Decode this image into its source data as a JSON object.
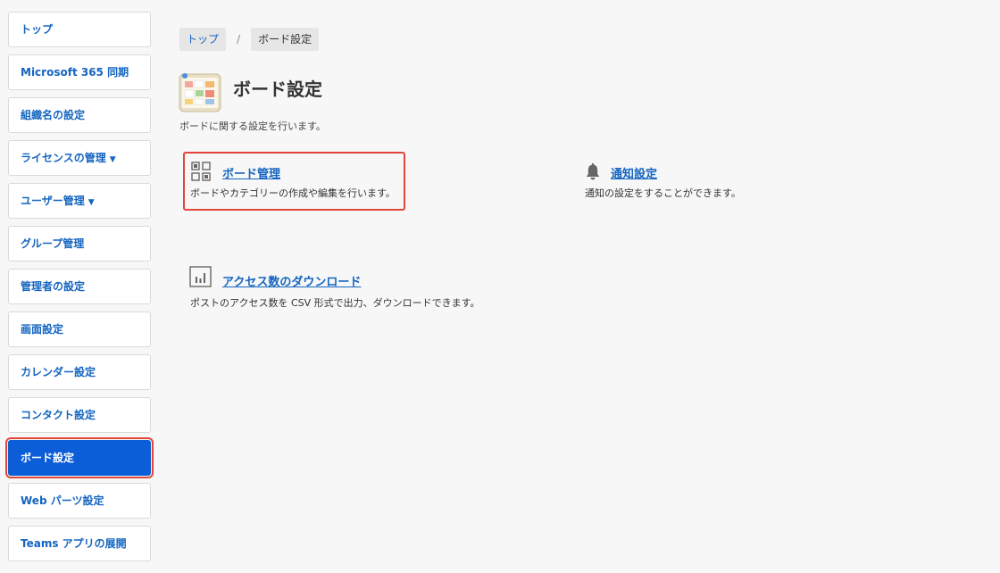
{
  "sidebar": {
    "items": [
      {
        "label": "トップ",
        "caret": ""
      },
      {
        "label": "Microsoft 365 同期",
        "caret": ""
      },
      {
        "label": "組織名の設定",
        "caret": ""
      },
      {
        "label": "ライセンスの管理",
        "caret": "▼"
      },
      {
        "label": "ユーザー管理",
        "caret": "▼"
      },
      {
        "label": "グループ管理",
        "caret": ""
      },
      {
        "label": "管理者の設定",
        "caret": ""
      },
      {
        "label": "画面設定",
        "caret": ""
      },
      {
        "label": "カレンダー設定",
        "caret": ""
      },
      {
        "label": "コンタクト設定",
        "caret": ""
      },
      {
        "label": "ボード設定",
        "caret": ""
      },
      {
        "label": "Web パーツ設定",
        "caret": ""
      },
      {
        "label": "Teams アプリの展開",
        "caret": ""
      }
    ],
    "active_index": 10
  },
  "breadcrumb": {
    "home": "トップ",
    "separator": "/",
    "current": "ボード設定"
  },
  "header": {
    "title": "ボード設定",
    "description": "ボードに関する設定を行います。",
    "icon": "board-app-icon"
  },
  "cards": {
    "board_manage": {
      "title": "ボード管理",
      "description": "ボードやカテゴリーの作成や編集を行います。",
      "icon": "grid-icon"
    },
    "notification": {
      "title": "通知設定",
      "description": "通知の設定をすることができます。",
      "icon": "bell-icon"
    },
    "access_download": {
      "title": "アクセス数のダウンロード",
      "description": "ポストのアクセス数を CSV 形式で出力、ダウンロードできます。",
      "icon": "bar-chart-icon"
    }
  },
  "colors": {
    "accent": "#0b5ed7",
    "link": "#1565c0",
    "highlight": "#e0463b",
    "background": "#f7f7f7"
  }
}
